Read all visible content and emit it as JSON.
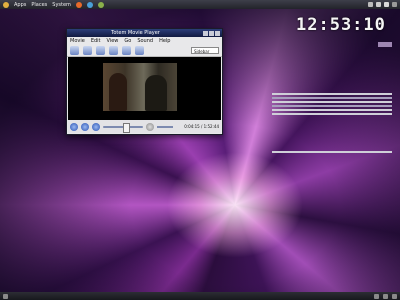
{
  "top_panel": {
    "menus": [
      "Apps",
      "Places",
      "System"
    ]
  },
  "player": {
    "title": "Totem Movie Player",
    "menus": [
      "Movie",
      "Edit",
      "View",
      "Go",
      "Sound",
      "Help"
    ],
    "combo": "Sidebar",
    "time": "0:04:15 / 1:52:44"
  },
  "clock": "12:53:10",
  "colors": {
    "panel": "#2c2d34",
    "titlebar": "#111a40"
  }
}
